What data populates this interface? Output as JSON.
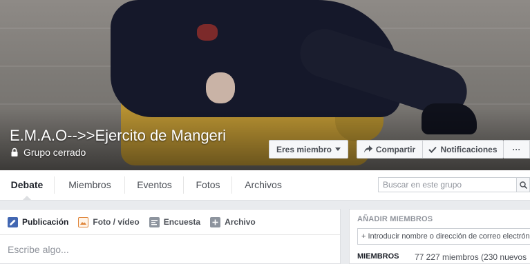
{
  "group": {
    "title": "E.M.A.O-->>Ejercito de Mangeri",
    "privacy": "Grupo cerrado"
  },
  "cover_buttons": {
    "member": "Eres miembro",
    "share": "Compartir",
    "notifications": "Notificaciones",
    "more": "···"
  },
  "tabs": [
    {
      "label": "Debate",
      "active": true
    },
    {
      "label": "Miembros"
    },
    {
      "label": "Eventos"
    },
    {
      "label": "Fotos"
    },
    {
      "label": "Archivos"
    }
  ],
  "search": {
    "placeholder": "Buscar en este grupo"
  },
  "composer": {
    "tabs": [
      {
        "label": "Publicación",
        "icon": "pencil-icon"
      },
      {
        "label": "Foto / vídeo",
        "icon": "photo-icon"
      },
      {
        "label": "Encuesta",
        "icon": "poll-icon"
      },
      {
        "label": "Archivo",
        "icon": "plus-icon"
      }
    ],
    "placeholder": "Escribe algo..."
  },
  "sidebar": {
    "add_members_heading": "AÑADIR MIEMBROS",
    "add_members_placeholder": "+ Introducir nombre o dirección de correo electrónico",
    "members_label": "MIEMBROS",
    "members_count": "77 227 miembros (230 nuevos"
  },
  "colors": {
    "accent": "#4267b2",
    "text_dark": "#1d2129",
    "text_muted": "#90949c",
    "background": "#e9ebee"
  }
}
